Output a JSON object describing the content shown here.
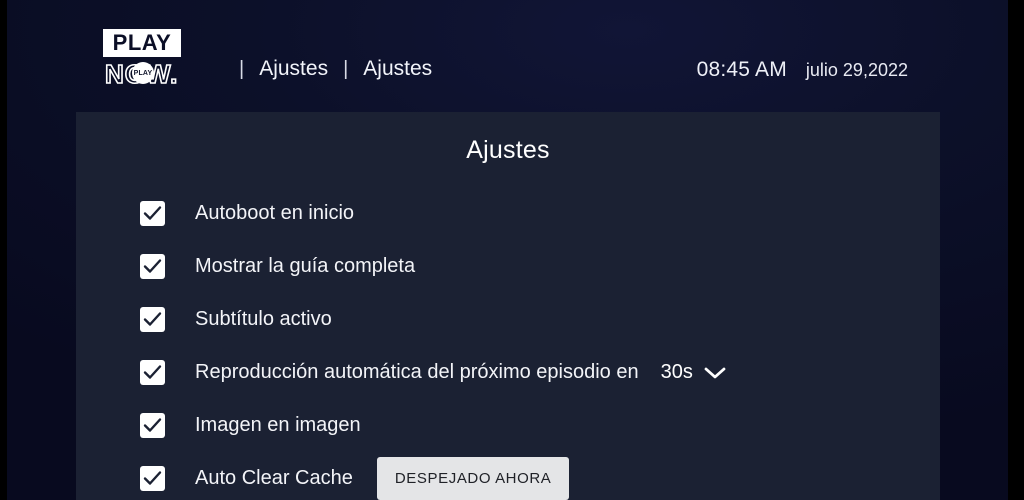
{
  "header": {
    "logo": {
      "play_text": "PLAY",
      "now_text": "NOW.",
      "badge_text": "PLAY"
    },
    "breadcrumb": {
      "separator": "|",
      "items": [
        "Ajustes",
        "Ajustes"
      ]
    },
    "time": "08:45 AM",
    "date": "julio 29,2022"
  },
  "panel": {
    "title": "Ajustes",
    "settings": [
      {
        "label": "Autoboot en inicio",
        "checked": true
      },
      {
        "label": "Mostrar la guía completa",
        "checked": true
      },
      {
        "label": "Subtítulo activo",
        "checked": true
      },
      {
        "label": "Reproducción automática del próximo episodio en",
        "checked": true,
        "dropdown_value": "30s"
      },
      {
        "label": "Imagen en imagen",
        "checked": true
      },
      {
        "label": "Auto Clear Cache",
        "checked": true,
        "button_label": "DESPEJADO AHORA"
      }
    ]
  },
  "colors": {
    "background": "#0a0c24",
    "panel": "#1b2133",
    "text": "#f3f4f8",
    "button_bg": "#e4e5e7",
    "button_text": "#202228",
    "checkbox_bg": "#ffffff",
    "checkmark": "#1b2133"
  }
}
